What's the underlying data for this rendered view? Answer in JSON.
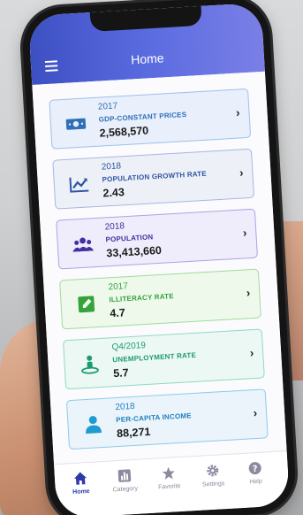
{
  "appbar": {
    "title": "Home"
  },
  "cards": [
    {
      "year": "2017",
      "label": "GDP-CONSTANT PRICES",
      "value": "2,568,570",
      "icon": "money-icon"
    },
    {
      "year": "2018",
      "label": "POPULATION GROWTH RATE",
      "value": "2.43",
      "icon": "trend-chart-icon"
    },
    {
      "year": "2018",
      "label": "POPULATION",
      "value": "33,413,660",
      "icon": "people-icon"
    },
    {
      "year": "2017",
      "label": "ILLITERACY RATE",
      "value": "4.7",
      "icon": "pencil-icon"
    },
    {
      "year": "Q4/2019",
      "label": "UNEMPLOYMENT RATE",
      "value": "5.7",
      "icon": "person-location-icon"
    },
    {
      "year": "2018",
      "label": "PER-CAPITA INCOME",
      "value": "88,271",
      "icon": "person-icon"
    }
  ],
  "chevron": "›",
  "nav": [
    {
      "label": "Home",
      "icon": "home-icon",
      "active": true
    },
    {
      "label": "Category",
      "icon": "bar-chart-icon"
    },
    {
      "label": "Favorite",
      "icon": "star-icon"
    },
    {
      "label": "Settings",
      "icon": "gear-icon"
    },
    {
      "label": "Help",
      "icon": "help-icon"
    }
  ],
  "colors": {
    "appbar_start": "#3d50c2",
    "appbar_end": "#7a7fe6",
    "nav_active": "#2f3aa8"
  }
}
